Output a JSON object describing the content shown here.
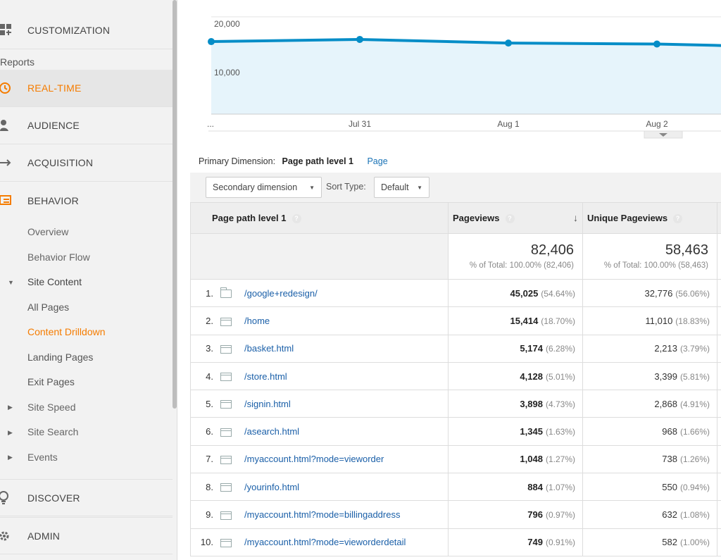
{
  "sidebar": {
    "customization": "CUSTOMIZATION",
    "reports": "Reports",
    "realtime": "REAL-TIME",
    "audience": "AUDIENCE",
    "acquisition": "ACQUISITION",
    "behavior": "BEHAVIOR",
    "overview": "Overview",
    "behavior_flow": "Behavior Flow",
    "site_content": "Site Content",
    "all_pages": "All Pages",
    "content_drilldown": "Content Drilldown",
    "landing_pages": "Landing Pages",
    "exit_pages": "Exit Pages",
    "site_speed": "Site Speed",
    "site_search": "Site Search",
    "events": "Events",
    "discover": "DISCOVER",
    "admin": "ADMIN"
  },
  "chart_data": {
    "type": "area",
    "title": "",
    "y_tick_labels": [
      "20,000",
      "10,000"
    ],
    "x_tick_labels": [
      "...",
      "Jul 31",
      "Aug 1",
      "Aug 2"
    ],
    "ylim": [
      0,
      22000
    ],
    "series": [
      {
        "name": "",
        "values": [
          14900,
          15350,
          14600,
          14400,
          13700
        ]
      }
    ],
    "accent": "#058dc7",
    "fill": "#e6f4fb"
  },
  "primary_dimension": {
    "label": "Primary Dimension:",
    "current": "Page path level 1",
    "alt": "Page"
  },
  "controls": {
    "secondary": "Secondary dimension",
    "sort_label": "Sort Type:",
    "sort_value": "Default"
  },
  "table": {
    "headers": {
      "path": "Page path level 1",
      "pageviews": "Pageviews",
      "unique": "Unique Pageviews"
    },
    "totals": {
      "pageviews": "82,406",
      "pageviews_sub": "% of Total: 100.00% (82,406)",
      "unique": "58,463",
      "unique_sub": "% of Total: 100.00% (58,463)"
    },
    "rows": [
      {
        "idx": "1.",
        "path": "/google+redesign/",
        "pv": "45,025",
        "pvp": "(54.64%)",
        "upv": "32,776",
        "upvp": "(56.06%)"
      },
      {
        "idx": "2.",
        "path": "/home",
        "pv": "15,414",
        "pvp": "(18.70%)",
        "upv": "11,010",
        "upvp": "(18.83%)"
      },
      {
        "idx": "3.",
        "path": "/basket.html",
        "pv": "5,174",
        "pvp": "(6.28%)",
        "upv": "2,213",
        "upvp": "(3.79%)"
      },
      {
        "idx": "4.",
        "path": "/store.html",
        "pv": "4,128",
        "pvp": "(5.01%)",
        "upv": "3,399",
        "upvp": "(5.81%)"
      },
      {
        "idx": "5.",
        "path": "/signin.html",
        "pv": "3,898",
        "pvp": "(4.73%)",
        "upv": "2,868",
        "upvp": "(4.91%)"
      },
      {
        "idx": "6.",
        "path": "/asearch.html",
        "pv": "1,345",
        "pvp": "(1.63%)",
        "upv": "968",
        "upvp": "(1.66%)"
      },
      {
        "idx": "7.",
        "path": "/myaccount.html?mode=vieworder",
        "pv": "1,048",
        "pvp": "(1.27%)",
        "upv": "738",
        "upvp": "(1.26%)"
      },
      {
        "idx": "8.",
        "path": "/yourinfo.html",
        "pv": "884",
        "pvp": "(1.07%)",
        "upv": "550",
        "upvp": "(0.94%)"
      },
      {
        "idx": "9.",
        "path": "/myaccount.html?mode=billingaddress",
        "pv": "796",
        "pvp": "(0.97%)",
        "upv": "632",
        "upvp": "(1.08%)"
      },
      {
        "idx": "10.",
        "path": "/myaccount.html?mode=vieworderdetail",
        "pv": "749",
        "pvp": "(0.91%)",
        "upv": "582",
        "upvp": "(1.00%)"
      }
    ]
  }
}
